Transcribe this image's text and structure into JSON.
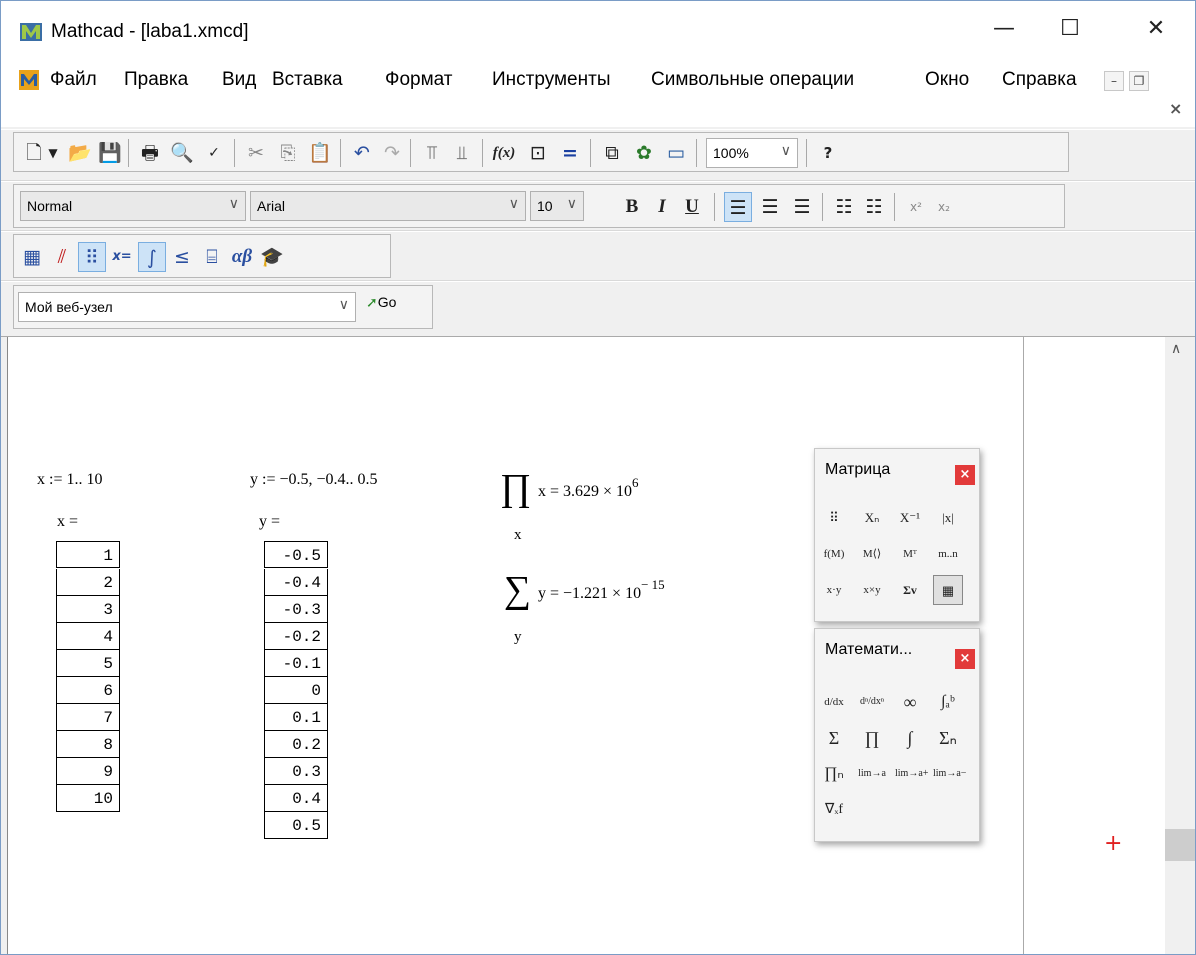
{
  "window": {
    "title": "Mathcad - [laba1.xmcd]"
  },
  "menu": [
    "Файл",
    "Правка",
    "Вид",
    "Вставка",
    "Формат",
    "Инструменты",
    "Символьные операции",
    "Окно",
    "Справка"
  ],
  "toolbar": {
    "zoom": "100%"
  },
  "format_bar": {
    "style": "Normal",
    "font": "Arial",
    "size": "10",
    "bold": "B",
    "italic": "I",
    "underline": "U"
  },
  "web_bar": {
    "address": "Мой веб-узел",
    "go": "Go"
  },
  "sheet": {
    "x_def": "x := 1.. 10",
    "y_def": "y := −0.5, −0.4.. 0.5",
    "x_eval": "x =",
    "y_eval": "y =",
    "x_values": [
      "1",
      "2",
      "3",
      "4",
      "5",
      "6",
      "7",
      "8",
      "9",
      "10"
    ],
    "y_values": [
      "-0.5",
      "-0.4",
      "-0.3",
      "-0.2",
      "-0.1",
      "0",
      "0.1",
      "0.2",
      "0.3",
      "0.4",
      "0.5"
    ],
    "prod_expr": "x = 3.629 × 10",
    "prod_exp": "6",
    "prod_sub": "x",
    "sum_expr": "y = −1.221 × 10",
    "sum_exp": "− 15",
    "sum_sub": "y"
  },
  "palettes": {
    "matrix": {
      "title": "Матрица"
    },
    "calculus": {
      "title": "Математи..."
    }
  }
}
